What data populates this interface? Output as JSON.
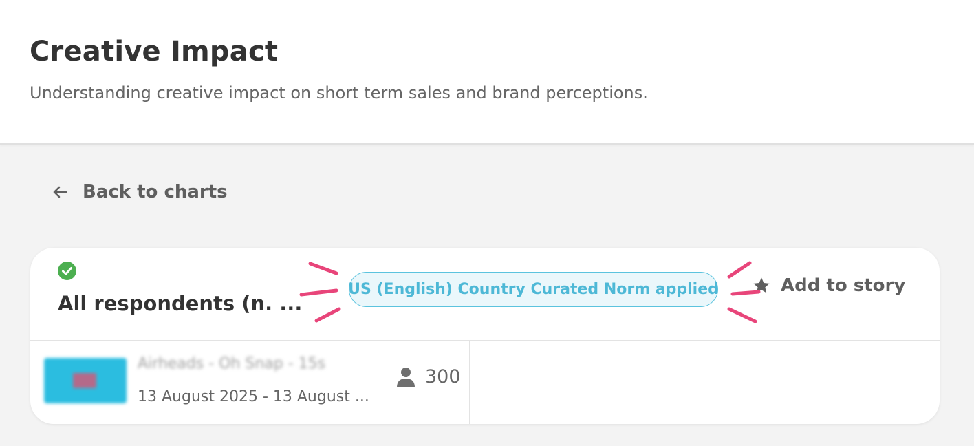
{
  "header": {
    "title": "Creative Impact",
    "subtitle": "Understanding creative impact on short term sales and brand perceptions."
  },
  "nav": {
    "back_label": "Back to charts",
    "back_icon": "arrow-left-icon"
  },
  "card": {
    "status_icon": "check-circle-icon",
    "audience_label": "All respondents (n. ...",
    "norm_badge": "US (English) Country Curated Norm applied",
    "add_to_story_label": "Add to story",
    "add_to_story_icon": "star-icon",
    "creative": {
      "name": "Airheads - Oh Snap - 15s",
      "dates": "13 August 2025 - 13 August ...",
      "respondents": "300",
      "respondents_icon": "person-icon"
    }
  },
  "colors": {
    "accent_teal": "#4db8d6",
    "success_green": "#4caf50",
    "highlight_pink": "#e8457a",
    "text_dark": "#333333",
    "text_muted": "#666666"
  }
}
